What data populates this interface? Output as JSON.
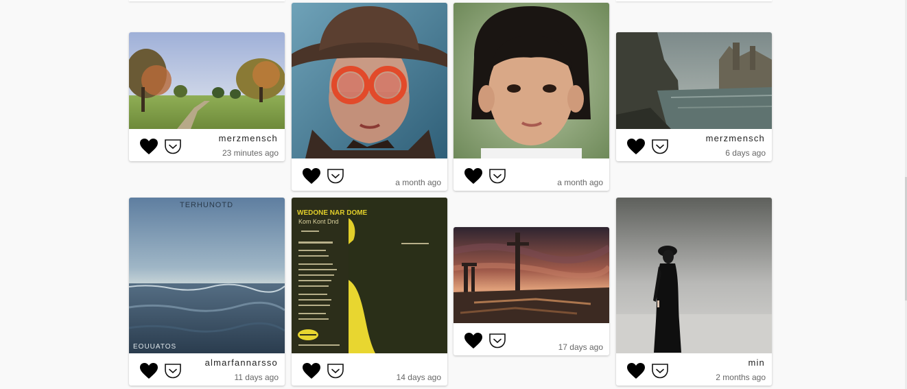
{
  "cards": [
    {
      "author": "merzmensch",
      "time": "23 minutes ago",
      "image": "landscape with trees and path"
    },
    {
      "author": "",
      "time": "a month ago",
      "image": "painted portrait of person with hat and red round glasses"
    },
    {
      "author": "",
      "time": "a month ago",
      "image": "photo portrait of young girl with bangs"
    },
    {
      "author": "merzmensch",
      "time": "6 days ago",
      "image": "ruined city by a river"
    },
    {
      "author": "almarfannarsso",
      "time": "11 days ago",
      "image": "stormy sea painting"
    },
    {
      "author": "",
      "time": "14 days ago",
      "image": "dark green poster with yellow shapes"
    },
    {
      "author": "",
      "time": "17 days ago",
      "image": "sunset over ruined towers"
    },
    {
      "author": "min",
      "time": "2 months ago",
      "image": "figure in black coat in grey studio"
    }
  ],
  "poster_texts": {
    "sea_top": "TERHUNOTD",
    "sea_bottom": "EOUUATOS",
    "poster_title": "WEDONE NAR DOME",
    "poster_sub": "Kom Kont Dnd"
  },
  "colors": {
    "background": "#f9f9f9",
    "card": "#ffffff",
    "text": "#222222",
    "muted": "#666666"
  },
  "icons": {
    "like": "heart-icon",
    "save": "pocket-save-icon"
  }
}
